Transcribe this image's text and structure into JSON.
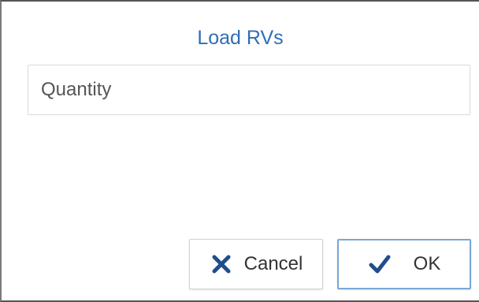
{
  "dialog": {
    "title": "Load RVs",
    "quantity_field": {
      "placeholder": "Quantity",
      "value": ""
    },
    "cancel_button": {
      "label": "Cancel",
      "icon": "close-icon"
    },
    "ok_button": {
      "label": "OK",
      "icon": "checkmark-icon"
    }
  },
  "colors": {
    "accent": "#2f6eb5",
    "icon": "#1f4e8c"
  }
}
